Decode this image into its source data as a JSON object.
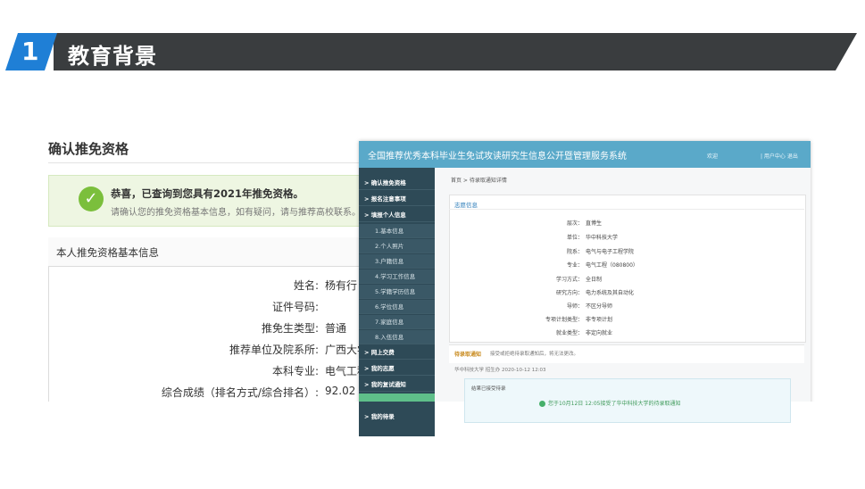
{
  "section": {
    "number": "1",
    "title": "教育背景"
  },
  "page": {
    "title": "确认推免资格",
    "success_title": "恭喜，已查询到您具有2021年推免资格。",
    "success_sub": "请确认您的推免资格基本信息，如有疑问，请与推荐高校联系。",
    "panel_title": "本人推免资格基本信息",
    "fields": [
      {
        "label": "姓名:",
        "value": "杨有行"
      },
      {
        "label": "证件号码:",
        "value": ""
      },
      {
        "label": "推免生类型:",
        "value": "普通"
      },
      {
        "label": "推荐单位及院系所:",
        "value": "广西大学"
      },
      {
        "label": "本科专业:",
        "value": "电气工程"
      },
      {
        "label": "综合成绩（排名方式/综合排名）:",
        "value": "92.02"
      }
    ]
  },
  "system": {
    "title": "全国推荐优秀本科毕业生免试攻读研究生信息公开暨管理服务系统",
    "user": "欢迎",
    "nav": "| 用户中心  退出",
    "sidebar": [
      {
        "label": "> 确认推免资格",
        "kind": "main"
      },
      {
        "label": "> 报名注意事项",
        "kind": "main"
      },
      {
        "label": "> 填报个人信息",
        "kind": "main"
      },
      {
        "label": "1.基本信息",
        "kind": "sub"
      },
      {
        "label": "2.个人照片",
        "kind": "sub"
      },
      {
        "label": "3.户籍信息",
        "kind": "sub"
      },
      {
        "label": "4.学习工作信息",
        "kind": "sub"
      },
      {
        "label": "5.学籍学历信息",
        "kind": "sub"
      },
      {
        "label": "6.学位信息",
        "kind": "sub"
      },
      {
        "label": "7.家庭信息",
        "kind": "sub"
      },
      {
        "label": "8.入伍信息",
        "kind": "sub"
      },
      {
        "label": "> 网上交费",
        "kind": "main"
      },
      {
        "label": "> 我的志愿",
        "kind": "main"
      },
      {
        "label": "> 我的复试通知",
        "kind": "main"
      },
      {
        "label": "",
        "kind": "active"
      },
      {
        "label": "> 我的待录",
        "kind": "main"
      }
    ],
    "breadcrumb": "首页 > 待录取通知详情",
    "card_title": "志愿信息",
    "details": [
      {
        "label": "层次：",
        "value": "直博生"
      },
      {
        "label": "单位：",
        "value": "华中科技大学"
      },
      {
        "label": "院系：",
        "value": "电气与电子工程学院"
      },
      {
        "label": "专业：",
        "value": "电气工程（080800）"
      },
      {
        "label": "学习方式：",
        "value": "全日制"
      },
      {
        "label": "研究方向：",
        "value": "电力系统及其自动化"
      },
      {
        "label": "导师：",
        "value": "不区分导师"
      },
      {
        "label": "专项计划类型：",
        "value": "非专项计划"
      },
      {
        "label": "就业类型：",
        "value": "非定向就业"
      }
    ],
    "notice_title": "待录取通知",
    "notice_desc": "接受或拒绝待录取通知后，将无法更改。",
    "notice_meta": "华中科技大学 招生办 2020-10-12 12:03",
    "msg_left": "结果已接受待录",
    "toast": "您于10月12日 12:05接受了华中科技大学的待录取通知"
  }
}
